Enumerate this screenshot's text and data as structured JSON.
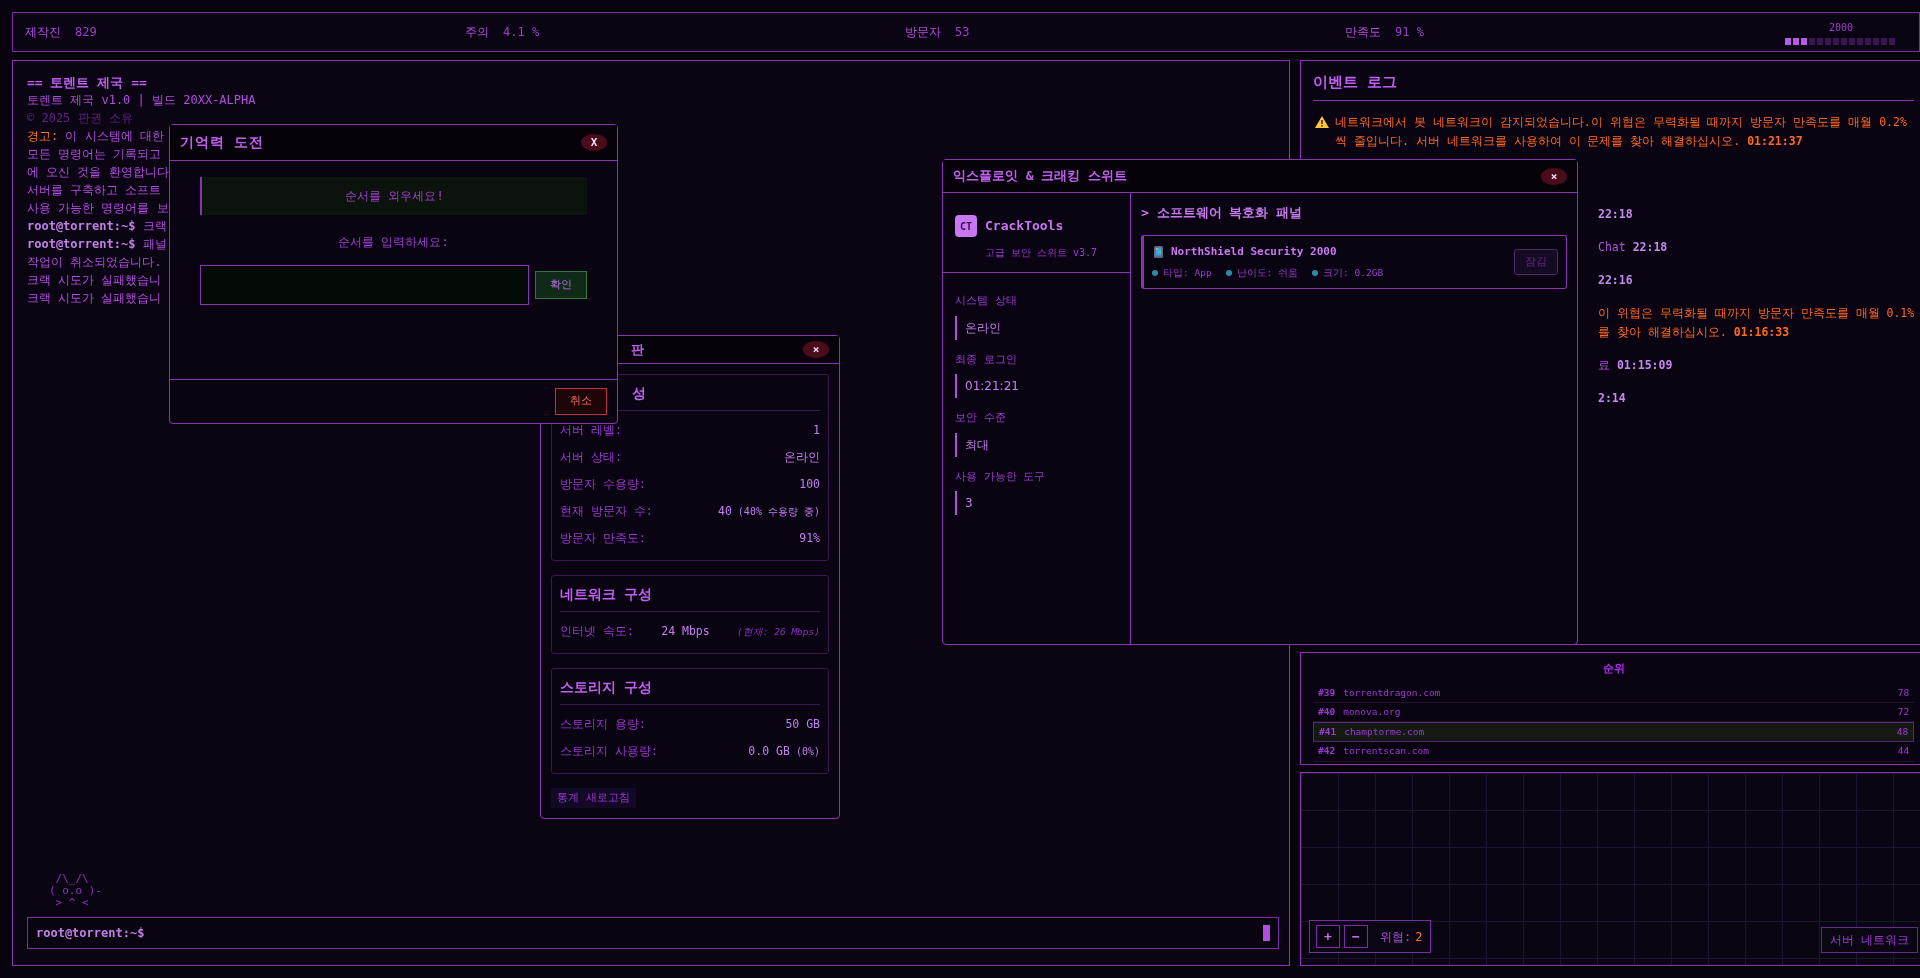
{
  "top_bar": {
    "stats": [
      {
        "label": "제작진",
        "value": "829"
      },
      {
        "label": "주의",
        "value": "4.1 %"
      },
      {
        "label": "방문자",
        "value": "53"
      },
      {
        "label": "만족도",
        "value": "91 %"
      }
    ],
    "year": "2000",
    "progress": {
      "level": 0.21
    }
  },
  "terminal": {
    "lines": [
      {
        "kind": "title",
        "text": "== 토렌트 제국 =="
      },
      {
        "kind": "plain",
        "text": "토렌트 제국 v1.0 | 빌드 20XX-ALPHA"
      },
      {
        "kind": "dim",
        "text": "© 2025 판권 소유"
      },
      {
        "kind": "warning",
        "label": "경고:",
        "text": "이 시스템에 대한"
      },
      {
        "kind": "plain",
        "text": "모든 명령어는 기록되고"
      },
      {
        "kind": "plain",
        "text": "에 오신 것을 환영합니다"
      },
      {
        "kind": "plain",
        "text": "서버를 구축하고 소프트"
      },
      {
        "kind": "plain",
        "text": "사용 가능한 명령어를 보"
      },
      {
        "kind": "command",
        "prompt": "root@torrent:~$",
        "text": "크랙"
      },
      {
        "kind": "command",
        "prompt": "root@torrent:~$",
        "text": "패널"
      },
      {
        "kind": "plain",
        "text": "작업이 취소되었습니다."
      },
      {
        "kind": "plain",
        "text": "크랙 시도가 실패했습니"
      },
      {
        "kind": "plain",
        "text": "크랙 시도가 실패했습니"
      }
    ],
    "ascii_art": [
      " /\\_/\\",
      "( o.o )-",
      " > ^ <"
    ],
    "input": {
      "prompt": "root@torrent:~$"
    }
  },
  "memory_dialog": {
    "title": "기억력 도전",
    "close": "X",
    "banner": "순서를 외우세요!",
    "prompt": "순서를 입력하세요:",
    "confirm": "확인",
    "cancel": "취소"
  },
  "server_window": {
    "title": "판",
    "close": "×",
    "sections": [
      {
        "title": "성",
        "rows": [
          {
            "kind": "plain",
            "label": "서버 레벨:",
            "value": "1"
          },
          {
            "kind": "plain",
            "label": "서버 상태:",
            "value": "온라인"
          },
          {
            "kind": "plain",
            "label": "방문자 수용량:",
            "value": "100"
          },
          {
            "kind": "with_note",
            "label": "현재 방문자 수:",
            "value": "40",
            "note": "(40% 수용량 중)"
          },
          {
            "kind": "plain",
            "label": "방문자 만족도:",
            "value": "91%"
          }
        ]
      },
      {
        "title": "네트워크 구성",
        "rows": [
          {
            "kind": "split",
            "label": "인터넷 속도:",
            "value": "24 Mbps",
            "note": "(현재: 26 Mbps)"
          }
        ]
      },
      {
        "title": "스토리지 구성",
        "rows": [
          {
            "kind": "plain",
            "label": "스토리지 용량:",
            "value": "50 GB"
          },
          {
            "kind": "with_note",
            "label": "스토리지 사용량:",
            "value": "0.0 GB",
            "note": "(0%)"
          }
        ]
      }
    ],
    "refresh": "통계 새로고침"
  },
  "exploit_window": {
    "title": "익스플로잇 & 크래킹 스위트",
    "close": "×",
    "logo": "CT",
    "app_name": "CrackTools",
    "subtitle": "고급 보안 스위트 v3.7",
    "stats": [
      {
        "label": "시스템 상태",
        "value": "온라인"
      },
      {
        "label": "최종 로그인",
        "value": "01:21:21"
      },
      {
        "label": "보안 수준",
        "value": "최대"
      },
      {
        "label": "사용 가능한 도구",
        "value": "3"
      }
    ],
    "panel_title": "> 소프트웨어 복호화 패널",
    "software": [
      {
        "name": "NorthShield Security 2000",
        "meta": [
          "타입: App",
          "난이도: 쉬움",
          "크기: 0.2GB"
        ],
        "action": "잠김",
        "locked": true
      }
    ]
  },
  "event_log": {
    "title": "이벤트 로그",
    "entries": [
      {
        "kind": "warning",
        "covered": false,
        "lines": [
          "네트워크에서 봇 네트워크이 감지되었습니다.이 위협은 무력화될 때까지 방문자 만족도를 매월 0.2% 씩 줄입니다. 서버 네트워크를 사용하여 이 문제를 찾아 해결하십시오."
        ],
        "time": "01:21:37"
      },
      {
        "kind": "info",
        "covered": true,
        "time": "22:18"
      },
      {
        "kind": "info",
        "covered": true,
        "lines": [
          "Chat"
        ],
        "time": "22:18"
      },
      {
        "kind": "info",
        "covered": true,
        "time": "22:16"
      },
      {
        "kind": "warning",
        "covered": true,
        "lines": [
          "이 위협은 무력화될 때까지 방문자 만족도를 매월 0.1%",
          "를 찾아 해결하십시오."
        ],
        "time": "01:16:33"
      },
      {
        "kind": "info",
        "covered": true,
        "lines": [
          "료"
        ],
        "time": "01:15:09"
      },
      {
        "kind": "info",
        "covered": true,
        "time": "2:14"
      }
    ]
  },
  "rankings": {
    "title": "순위",
    "rows": [
      {
        "rank": "#39",
        "site": "torrentdragon.com",
        "score": "78",
        "selected": false
      },
      {
        "rank": "#40",
        "site": "monova.org",
        "score": "72",
        "selected": false
      },
      {
        "rank": "#41",
        "site": "champtorme.com",
        "score": "48",
        "selected": true
      },
      {
        "rank": "#42",
        "site": "torrentscan.com",
        "score": "44",
        "selected": false
      }
    ]
  },
  "network": {
    "zoom_in": "+",
    "zoom_out": "−",
    "threat_label": "위협:",
    "threat_value": "2",
    "view_button": "서버 네트워크"
  }
}
